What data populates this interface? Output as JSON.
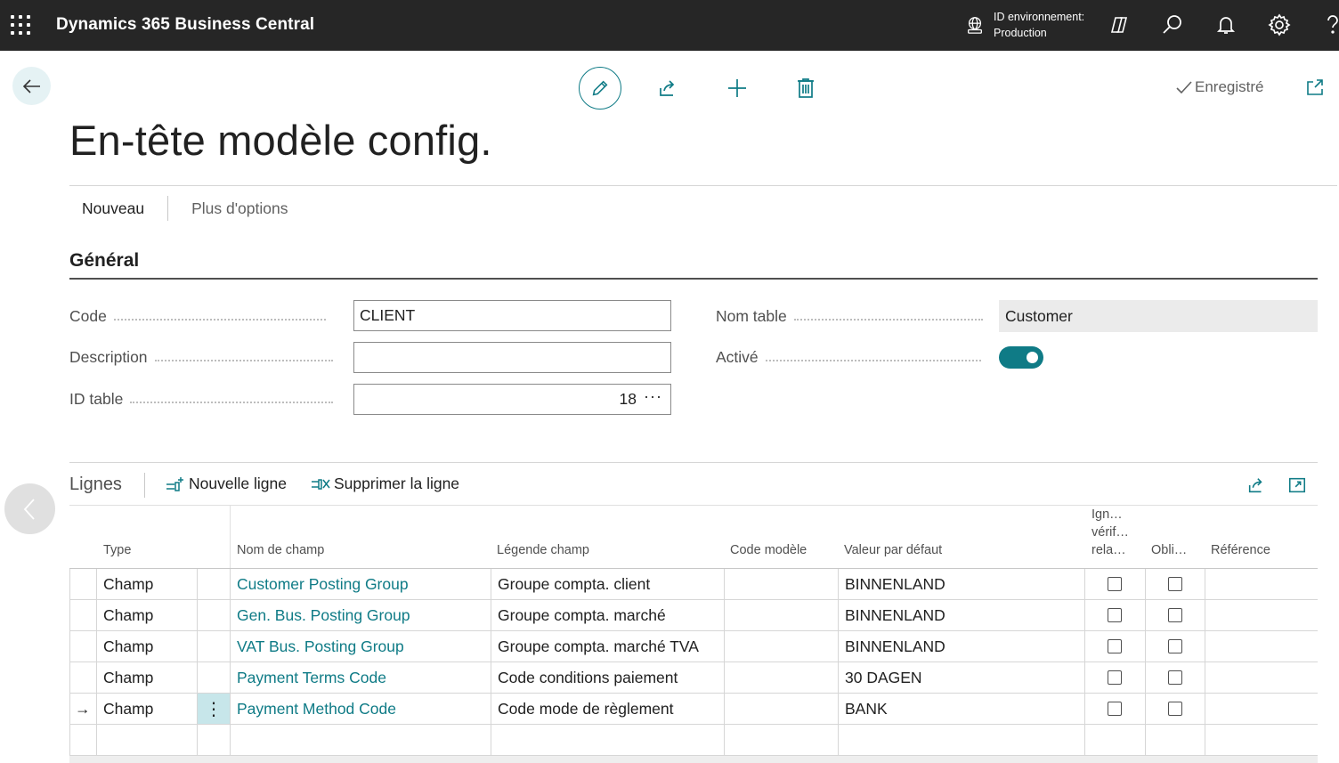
{
  "topbar": {
    "app_title": "Dynamics 365 Business Central",
    "env_line1": "ID environnement:",
    "env_line2": "Production"
  },
  "toolbar": {
    "saved_label": "Enregistré"
  },
  "page": {
    "title": "En-tête modèle config."
  },
  "menu": {
    "new_label": "Nouveau",
    "more_label": "Plus d'options"
  },
  "general": {
    "section_title": "Général",
    "code_label": "Code",
    "code_value": "CLIENT",
    "description_label": "Description",
    "description_value": "",
    "table_id_label": "ID table",
    "table_id_value": "18",
    "table_id_ellipsis": "···",
    "table_name_label": "Nom table",
    "table_name_value": "Customer",
    "active_label": "Activé",
    "active_value": true
  },
  "lines": {
    "title": "Lignes",
    "new_line_label": "Nouvelle ligne",
    "delete_line_label": "Supprimer la ligne",
    "columns": {
      "type": "Type",
      "field_name": "Nom de champ",
      "field_caption": "Légende champ",
      "template_code": "Code modèle",
      "default_value": "Valeur par défaut",
      "ignore_l1": "Ign…",
      "ignore_l2": "vérif…",
      "ignore_l3": "rela…",
      "mandatory": "Obli…",
      "reference": "Référence"
    },
    "rows": [
      {
        "type": "Champ",
        "field_name": "Customer Posting Group",
        "caption": "Groupe compta. client",
        "template_code": "",
        "default_value": "BINNENLAND",
        "ignore": false,
        "mandatory": false,
        "reference": ""
      },
      {
        "type": "Champ",
        "field_name": "Gen. Bus. Posting Group",
        "caption": "Groupe compta. marché",
        "template_code": "",
        "default_value": "BINNENLAND",
        "ignore": false,
        "mandatory": false,
        "reference": ""
      },
      {
        "type": "Champ",
        "field_name": "VAT Bus. Posting Group",
        "caption": "Groupe compta. marché TVA",
        "template_code": "",
        "default_value": "BINNENLAND",
        "ignore": false,
        "mandatory": false,
        "reference": ""
      },
      {
        "type": "Champ",
        "field_name": "Payment Terms Code",
        "caption": "Code conditions paiement",
        "template_code": "",
        "default_value": "30 DAGEN",
        "ignore": false,
        "mandatory": false,
        "reference": ""
      },
      {
        "type": "Champ",
        "field_name": "Payment Method Code",
        "caption": "Code mode de règlement",
        "template_code": "",
        "default_value": "BANK",
        "ignore": false,
        "mandatory": false,
        "reference": ""
      }
    ],
    "selected_row_marker": "→",
    "row_menu_glyph": "⋮"
  }
}
